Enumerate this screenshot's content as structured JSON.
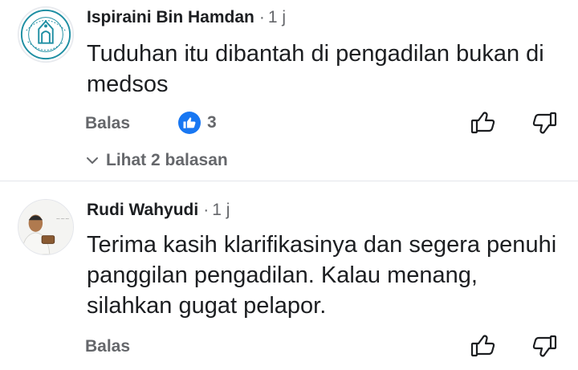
{
  "comments": [
    {
      "author": "Ispiraini Bin Hamdan",
      "separator": "·",
      "time": "1 j",
      "avatar_icon": "institution-logo-icon",
      "text": "Tuduhan itu dibantah di pengadilan bukan di medsos",
      "reply_label": "Balas",
      "reaction_icon": "like-icon",
      "reaction_count": "3",
      "view_replies_label": "Lihat 2 balasan"
    },
    {
      "author": "Rudi Wahyudi",
      "separator": "·",
      "time": "1 j",
      "avatar_icon": "user-photo-avatar",
      "text": "Terima kasih klarifikasinya dan segera penuhi panggilan pengadilan.  Kalau menang, silahkan gugat pelapor.",
      "reply_label": "Balas"
    }
  ],
  "colors": {
    "secondary_text": "#65676b",
    "primary_text": "#1c1e21",
    "like_blue": "#1877f2",
    "logo_teal": "#1f8fa3"
  }
}
